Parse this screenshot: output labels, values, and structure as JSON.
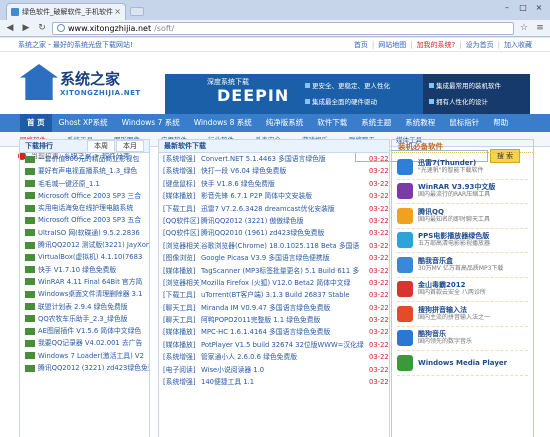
{
  "browser": {
    "tab_title": "绿色软件_破解软件_手机软件",
    "url_host": "www.xitongzhijia.net",
    "url_path": "/soft/"
  },
  "topbar": {
    "left_site": "系统之家",
    "left_slogan": "最好的系统光盘下载网站!",
    "links": [
      "首页",
      "网站地图",
      "加我的系统?",
      "设为首页",
      "加入收藏"
    ]
  },
  "header": {
    "logo_cn": "系统之家",
    "logo_en": "XITONGZHIJIA.NET",
    "banner_title": "深度系统下载",
    "banner_brand": "DEEPIN",
    "banner_features": [
      "更安全、更稳定、更人性化",
      "集成最常用的装机软件",
      "集成最全面的硬件驱动",
      "拥有人性化的设计"
    ]
  },
  "mainnav": [
    "首 页",
    "Ghost XP系统",
    "Windows 7 系统",
    "Windows 8 系统",
    "纯净版系统",
    "软件下载",
    "系统主题",
    "系统教程",
    "鼠标指针",
    "帮助"
  ],
  "subnav": [
    "网络软件",
    "系统工具",
    "图形图像",
    "应用软件",
    "行业软件",
    "杀毒安全",
    "游戏娱乐",
    "联络聊天",
    "媒体工具"
  ],
  "locbar": {
    "prefix": "当前位置:",
    "crumb1": "系统之家",
    "crumb2": "软件分类",
    "search_placeholder": "",
    "search_button": "搜 索"
  },
  "rank": {
    "title": "下载排行",
    "tab_week": "本周",
    "tab_month": "本月",
    "items": [
      "一套价值800元的精品商业影视包",
      "要好有声电视直播系统_1.3_绿色",
      "毛毛城一键还原_1.1",
      "Microsoft Office 2003 SP3 三合",
      "实用电话海免在线护理电脑系统",
      "Microsoft Office 2003 SP3 五合",
      "UltraISO 网(软碟通) 9.5.2.2836",
      "腾讯QQ2012 测试版(3221) JayXon",
      "VirtualBox(虚拟机) 4.1.10(7683",
      "快手 V1.7.10 绿色免费版",
      "WinRAR 4.11 Final 64Bit 官方简",
      "Windows桌面文件清理删除器 3.1",
      "联盟计划表 2.9.4 绿色免费版",
      "QQ农牧车乐助手_2.3_绿色版",
      "AE图层插件 V1.5.6 简体中文绿色",
      "我要QQ记录器 V4.02.001 去广告",
      "Windows 7 Loader(激活工具) V2",
      "腾讯QQ2012 (3221) zd423绿色免费"
    ]
  },
  "latest": {
    "title": "最新软件下载",
    "items": [
      {
        "cat": "[系统增强]",
        "title": "Convert.NET 5.1.4463 多国语言绿色版",
        "date": "03-22"
      },
      {
        "cat": "[系统增强]",
        "title": "快打一段 V6.04 绿色免费版",
        "date": "03-22"
      },
      {
        "cat": "[键盘鼠标]",
        "title": "快手 V1.8.6 绿色免费版",
        "date": "03-22"
      },
      {
        "cat": "[媒体播放]",
        "title": "影音先锋 6.7.1 P2P 简体中文安装版",
        "date": "03-22"
      },
      {
        "cat": "[下载工具]",
        "title": "迅雷7 V7.2.6.3428 dreamcast优化安装版",
        "date": "03-22"
      },
      {
        "cat": "[QQ软件区]",
        "title": "腾讯QQ2012 (3221) 傲傲绿色版",
        "date": "03-22"
      },
      {
        "cat": "[QQ软件区]",
        "title": "腾讯QQ2010 (1961) zd423绿色免费版",
        "date": "03-22"
      },
      {
        "cat": "[浏览器相关]",
        "title": "谷歌浏览器(Chrome) 18.0.1025.118 Beta 多国语",
        "date": "03-22"
      },
      {
        "cat": "[图像浏览]",
        "title": "Google Picasa V3.9 多国语言绿色便携版",
        "date": "03-22"
      },
      {
        "cat": "[媒体播放]",
        "title": "TagScanner (MP3标签批量更名) 5.1 Build 611 多",
        "date": "03-22"
      },
      {
        "cat": "[浏览器相关]",
        "title": "Mozilla Firefox (火狐) V12.0 Beta2 简体中文绿",
        "date": "03-22"
      },
      {
        "cat": "[下载工具]",
        "title": "uTorrent(BT客户端) 3.1.3 Build 26837 Stable",
        "date": "03-22"
      },
      {
        "cat": "[聊天工具]",
        "title": "Miranda IM V0.9.47 多国语言绿色免费版",
        "date": "03-22"
      },
      {
        "cat": "[聊天工具]",
        "title": "阿鸭POPO2011完整版 1.1 绿色免费版",
        "date": "03-22"
      },
      {
        "cat": "[媒体播放]",
        "title": "MPC-HC 1.6.1.4164 多国语言绿色免费版",
        "date": "03-22"
      },
      {
        "cat": "[媒体播放]",
        "title": "PotPlayer V1.5 build 32674 32位版WWW=汉化绿",
        "date": "03-22"
      },
      {
        "cat": "[系统增强]",
        "title": "管家通小人 2.6.0.6 绿色免费版",
        "date": "03-22"
      },
      {
        "cat": "[电子阅读]",
        "title": "Wise小说阅读器 1.0",
        "date": "03-22"
      },
      {
        "cat": "[系统增强]",
        "title": "140便捷工具 1.1",
        "date": "03-22"
      }
    ]
  },
  "essentials": {
    "title": "装机必备软件",
    "items": [
      {
        "name": "迅雷7(Thunder)",
        "desc": "\"光速帆\"的智能下载软件",
        "color": "#2f7fd8"
      },
      {
        "name": "WinRAR V3.93中文版",
        "desc": "国内最流行的RAR压缩工具",
        "color": "#7b3aa6"
      },
      {
        "name": "腾讯QQ",
        "desc": "国内最知名的即时聊天工具",
        "color": "#f1a120"
      },
      {
        "name": "PPS电影播放器绿色版",
        "desc": "五万部高清电影影视播放器",
        "color": "#2da3d6"
      },
      {
        "name": "酷我音乐盒",
        "desc": "30万MV 亿万首高品质MP3下载",
        "color": "#3d87d9"
      },
      {
        "name": "金山毒霸2012",
        "desc": "国内首款云安全 八两诊所",
        "color": "#d73630"
      },
      {
        "name": "搜狗拼音输入法",
        "desc": "国内主流的拼音输入法之一",
        "color": "#e34b2a"
      },
      {
        "name": "酷狗音乐",
        "desc": "国内领先的数字音乐",
        "color": "#2a78d2"
      },
      {
        "name": "Windows Media Player",
        "desc": "",
        "color": "#3a9a3a"
      }
    ]
  }
}
